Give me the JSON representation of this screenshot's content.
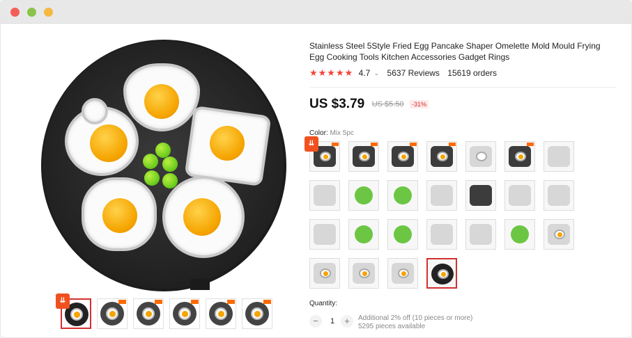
{
  "product": {
    "title": "Stainless Steel 5Style Fried Egg Pancake Shaper Omelette Mold Mould Frying Egg Cooking Tools Kitchen Accessories Gadget Rings",
    "rating": "4.7",
    "stars": "★★★★★",
    "reviews": "5637 Reviews",
    "orders": "15619 orders",
    "price": "US $3.79",
    "old_price": "US $5.50",
    "discount": "-31%"
  },
  "variant": {
    "label": "Color:",
    "selected": "Mix 5pc"
  },
  "quantity": {
    "label": "Quantity:",
    "value": "1",
    "minus": "−",
    "plus": "+",
    "note1": "Additional 2% off (10 pieces or more)",
    "note2": "5295 pieces available"
  },
  "icons": {
    "rating_caret": "chevron-down-icon",
    "promo_badge": "⇊"
  }
}
